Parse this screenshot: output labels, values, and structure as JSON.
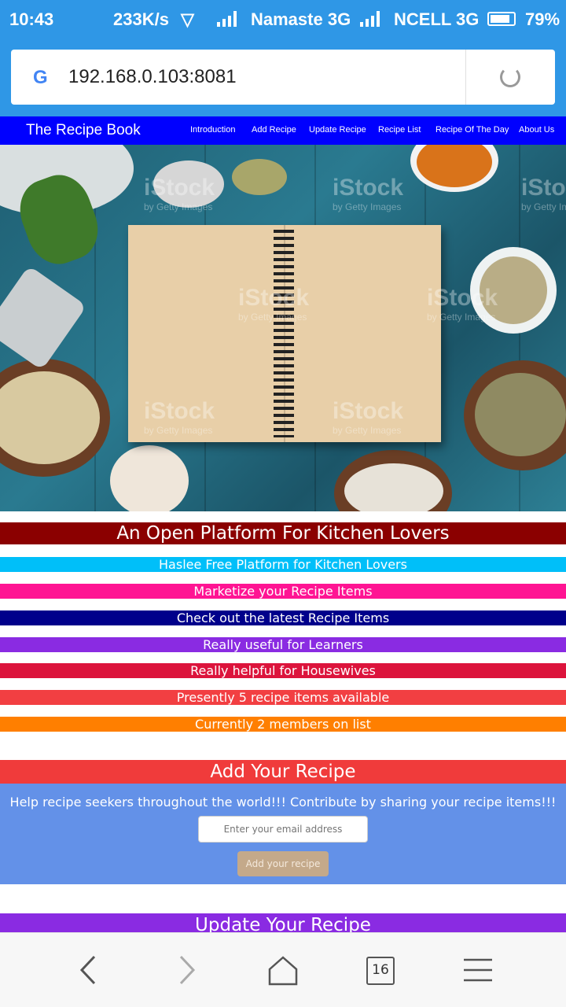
{
  "status_bar": {
    "time": "10:43",
    "speed": "233K/s",
    "carrier1": "Namaste 3G",
    "carrier2": "NCELL 3G",
    "battery": "79%"
  },
  "browser": {
    "url": "192.168.0.103:8081",
    "tab_count": "16"
  },
  "site": {
    "brand": "The Recipe Book",
    "nav": [
      "Introduction",
      "Add Recipe",
      "Update Recipe",
      "Recipe List",
      "Recipe Of The Day",
      "About Us"
    ]
  },
  "hero": {
    "watermark": "iStock",
    "watermark_sub": "by Getty Images"
  },
  "headline": "An Open Platform For Kitchen Lovers",
  "features": [
    {
      "text": "Haslee Free Platform for Kitchen Lovers",
      "color": "#00bff9"
    },
    {
      "text": "Marketize your Recipe Items",
      "color": "#ff1493"
    },
    {
      "text": "Check out the latest Recipe Items",
      "color": "#00008b"
    },
    {
      "text": "Really useful for Learners",
      "color": "#8a2be2"
    },
    {
      "text": "Really helpful for Housewives",
      "color": "#dc143c"
    },
    {
      "text": "Presently 5 recipe items available",
      "color": "#f23f42"
    },
    {
      "text": "Currently 2 members on list",
      "color": "#ff7f00"
    }
  ],
  "add_section": {
    "title": "Add Your Recipe",
    "help": "Help recipe seekers throughout the world!!! Contribute by sharing your recipe items!!!",
    "email_placeholder": "Enter your email address",
    "button": "Add your recipe"
  },
  "update_section": {
    "title": "Update Your Recipe"
  },
  "colors": {
    "status_bg": "#2f97e6",
    "nav_bg": "#0000ff",
    "headline_bg": "#8b0000",
    "add_title_bg": "#f03b3b",
    "add_section_bg": "#6391e8",
    "update_title_bg": "#8a2be2"
  }
}
